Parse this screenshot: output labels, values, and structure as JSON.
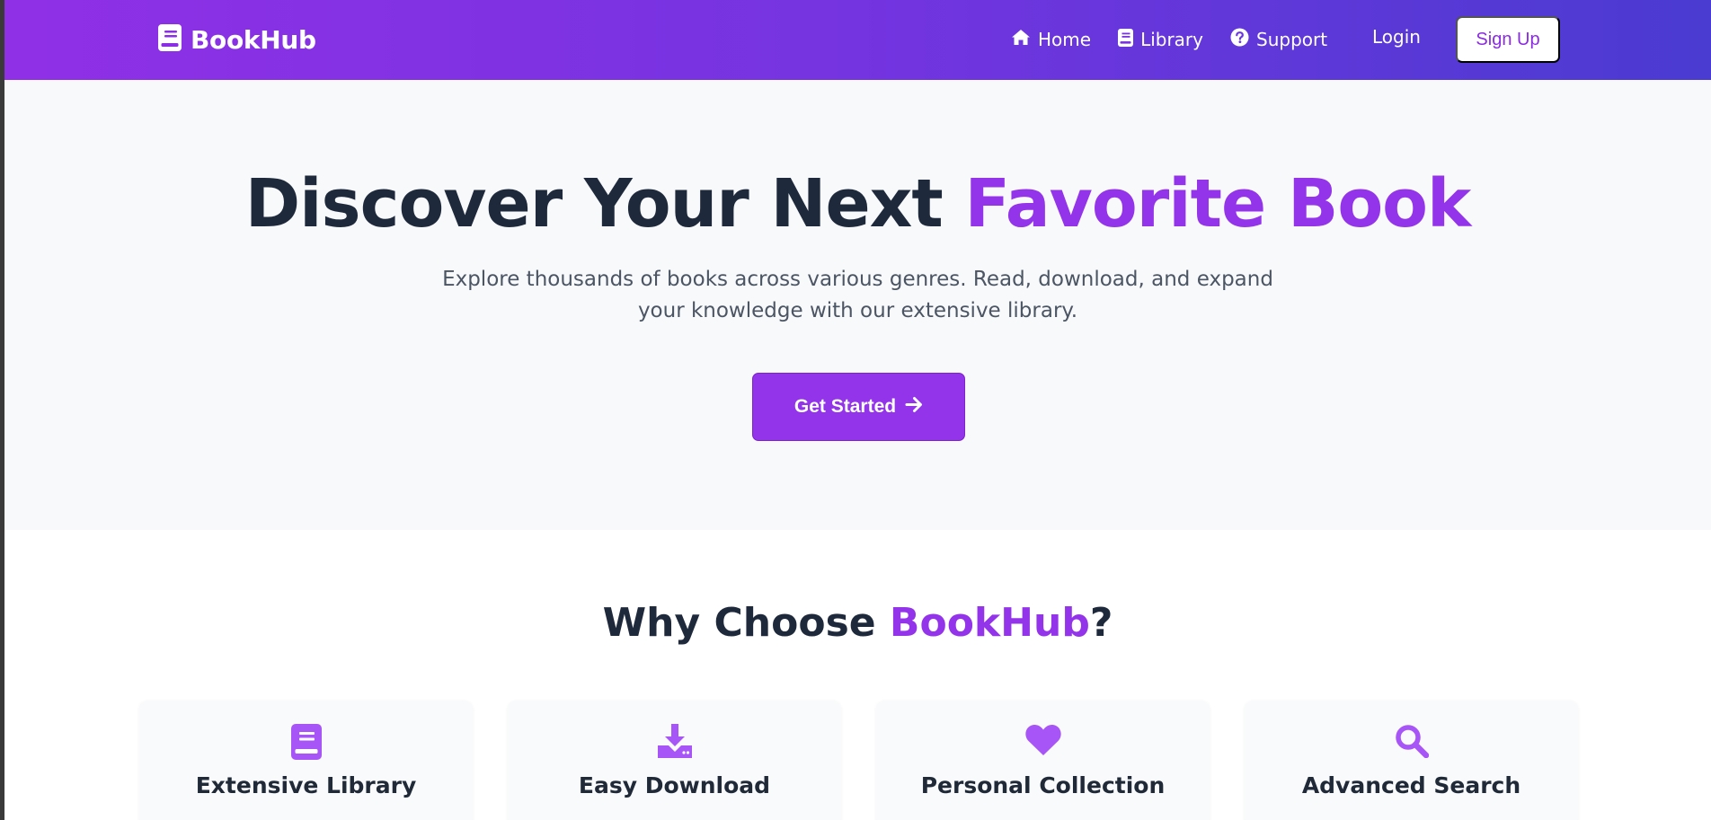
{
  "header": {
    "brand": "BookHub",
    "nav": [
      {
        "label": "Home",
        "icon": "home-icon"
      },
      {
        "label": "Library",
        "icon": "book-icon"
      },
      {
        "label": "Support",
        "icon": "question-circle-icon"
      }
    ],
    "login_label": "Login",
    "signup_label": "Sign Up"
  },
  "hero": {
    "title_plain": "Discover Your Next ",
    "title_accent": "Favorite Book",
    "subtitle_line1": "Explore thousands of books across various genres. Read, download, and expand",
    "subtitle_line2": "your knowledge with our extensive library.",
    "cta_label": "Get Started"
  },
  "features": {
    "title_plain": "Why Choose ",
    "title_accent": "BookHub",
    "title_suffix": "?",
    "cards": [
      {
        "title": "Extensive Library",
        "icon": "book-icon"
      },
      {
        "title": "Easy Download",
        "icon": "download-icon"
      },
      {
        "title": "Personal Collection",
        "icon": "heart-icon"
      },
      {
        "title": "Advanced Search",
        "icon": "search-icon"
      }
    ]
  },
  "colors": {
    "accent": "#9333ea",
    "heading": "#1e293b",
    "nav_gradient_start": "#9030e6",
    "nav_gradient_end": "#4a3bd1",
    "hero_bg": "#f8f9fb"
  }
}
